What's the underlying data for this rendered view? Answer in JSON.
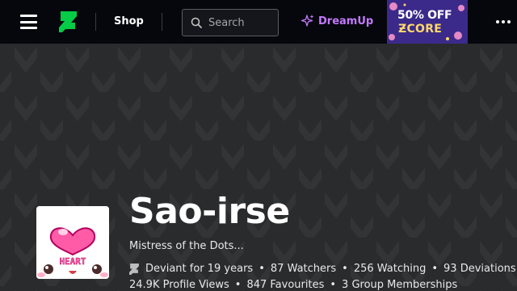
{
  "colors": {
    "header_bg": "#06070d",
    "brand_green": "#05cc47",
    "dreamup_purple": "#c479ff",
    "page_bg": "#262727"
  },
  "header": {
    "menu_icon": "hamburger-icon",
    "logo_icon": "deviantart-logo-icon",
    "shop_label": "Shop",
    "search_placeholder": "Search",
    "dreamup_label": "DreamUp",
    "promo": {
      "line1": "50% OFF",
      "line2": "ƵCORE"
    },
    "more_icon": "ellipsis-icon"
  },
  "profile": {
    "username": "Sao-irse",
    "tagline": "Mistress of the Dots...",
    "avatar_text": "HEART",
    "stats_row1": {
      "deviant_for": "Deviant for 19 years",
      "watchers": "87 Watchers",
      "watching": "256 Watching",
      "deviations": "93 Deviations"
    },
    "stats_row2": {
      "profile_views": "24.9K Profile Views",
      "favourites": "847 Favourites",
      "group_memberships": "3 Group Memberships"
    }
  }
}
